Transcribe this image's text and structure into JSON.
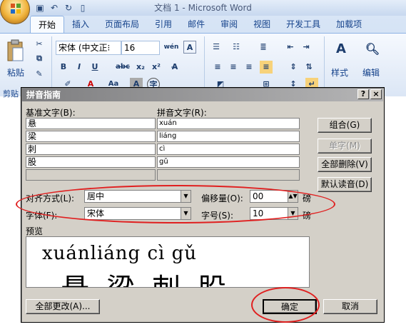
{
  "app": {
    "title": "文档 1 - Microsoft Word",
    "tabs": [
      "开始",
      "插入",
      "页面布局",
      "引用",
      "邮件",
      "审阅",
      "视图",
      "开发工具",
      "加载项"
    ],
    "active_tab": 0,
    "paste_label": "粘贴",
    "clipboard_group_label": "剪贴",
    "font_name": "宋体 (中文正⁝",
    "font_size": "16",
    "wen_label": "wén",
    "styles_label": "样式",
    "edit_label": "编辑"
  },
  "dialog": {
    "title": "拼音指南",
    "base_header": "基准文字(B):",
    "ruby_header": "拼音文字(R):",
    "rows": [
      {
        "base": "悬",
        "ruby": "xuán"
      },
      {
        "base": "梁",
        "ruby": "liáng"
      },
      {
        "base": "刺",
        "ruby": "cì"
      },
      {
        "base": "股",
        "ruby": "gǔ"
      },
      {
        "base": "",
        "ruby": ""
      }
    ],
    "buttons": {
      "combine": "组合(G)",
      "single": "单字(M)",
      "delete_all": "全部删除(V)",
      "default_reading": "默认读音(D)",
      "change_all": "全部更改(A)...",
      "ok": "确定",
      "cancel": "取消"
    },
    "alignment_label": "对齐方式(L):",
    "alignment_value": "居中",
    "offset_label": "偏移量(O):",
    "offset_value": "00",
    "offset_unit": "磅",
    "font_label": "字体(F):",
    "font_value": "宋体",
    "size_label": "字号(S):",
    "size_value": "10",
    "size_unit": "磅",
    "preview_label": "预览",
    "preview_ruby": "xuánliáng cì  gǔ",
    "preview_base": "悬梁刺股"
  },
  "colors": {
    "annotation": "#e02020",
    "title_bar": "#7e7e80"
  }
}
